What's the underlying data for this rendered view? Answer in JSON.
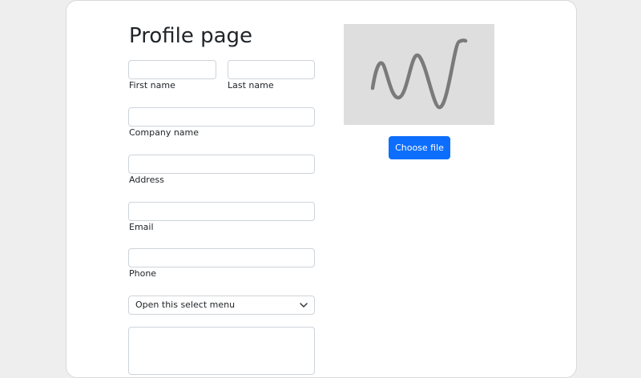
{
  "page": {
    "title": "Profile page"
  },
  "form": {
    "first_name": {
      "label": "First name",
      "value": ""
    },
    "last_name": {
      "label": "Last name",
      "value": ""
    },
    "company_name": {
      "label": "Company name",
      "value": ""
    },
    "address": {
      "label": "Address",
      "value": ""
    },
    "email": {
      "label": "Email",
      "value": ""
    },
    "phone": {
      "label": "Phone",
      "value": ""
    },
    "select": {
      "selected": "Open this select menu"
    },
    "notes": {
      "value": ""
    }
  },
  "upload": {
    "button_label": "Choose file"
  },
  "colors": {
    "primary": "#0d6efd",
    "image_bg": "#dedede",
    "signature_stroke": "#7a7a7a"
  }
}
